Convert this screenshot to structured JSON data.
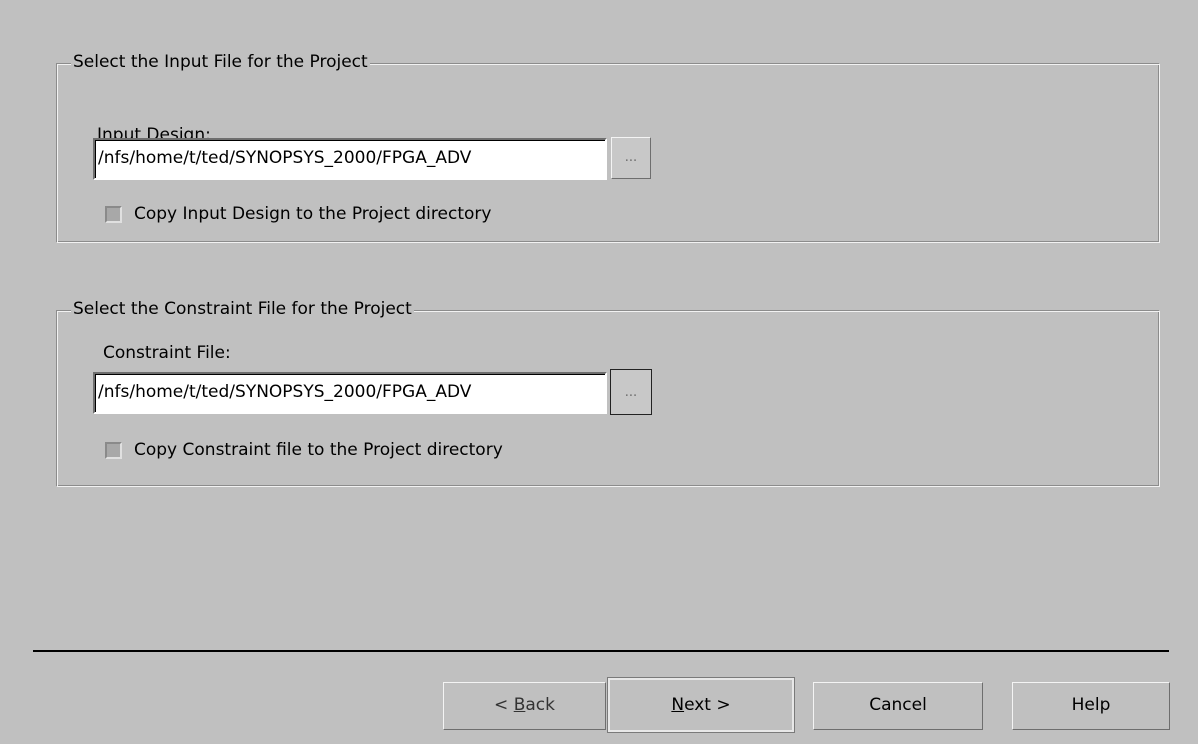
{
  "input_section": {
    "legend": "Select the Input File for the Project",
    "label": "Input Design:",
    "path_value": "/nfs/home/t/ted/SYNOPSYS_2000/FPGA_ADV",
    "browse_label": "...",
    "copy_checkbox_label": "Copy Input Design to the Project directory",
    "copy_checked": false
  },
  "constraint_section": {
    "legend": "Select the Constraint File for the Project",
    "label": "Constraint File:",
    "path_value": "/nfs/home/t/ted/SYNOPSYS_2000/FPGA_ADV",
    "browse_label": "...",
    "copy_checkbox_label": "Copy Constraint file to the Project directory",
    "copy_checked": false
  },
  "buttons": {
    "back_prefix": "< ",
    "back_mnemonic": "B",
    "back_rest": "ack",
    "next_mnemonic": "N",
    "next_rest": "ext >",
    "cancel": "Cancel",
    "help": "Help"
  },
  "colors": {
    "window_background": "#c0c0c0",
    "field_background": "#ffffff",
    "separator": "#000000"
  }
}
